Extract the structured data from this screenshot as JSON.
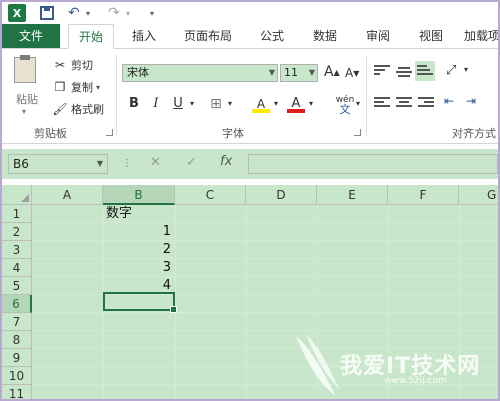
{
  "app_logo": "X",
  "tabs": [
    "文件",
    "开始",
    "插入",
    "页面布局",
    "公式",
    "数据",
    "审阅",
    "视图",
    "加载项"
  ],
  "active_tab": "开始",
  "ribbon": {
    "clipboard": {
      "paste": "粘贴",
      "cut": "剪切",
      "copy": "复制",
      "format_painter": "格式刷",
      "label": "剪贴板"
    },
    "font": {
      "name": "宋体",
      "size": "11",
      "grow": "A",
      "shrink": "A",
      "bold": "B",
      "italic": "I",
      "underline": "U",
      "phonetic": "wén",
      "phonetic_char": "文",
      "fill_char": "A",
      "font_color_char": "A",
      "label": "字体"
    },
    "alignment": {
      "label": "对齐方式"
    }
  },
  "formula_bar": {
    "name_box": "B6",
    "fx": "fx",
    "formula": ""
  },
  "grid": {
    "columns": [
      "A",
      "B",
      "C",
      "D",
      "E",
      "F",
      "G"
    ],
    "rows": [
      "1",
      "2",
      "3",
      "4",
      "5",
      "6",
      "7",
      "8",
      "9",
      "10",
      "11"
    ],
    "selected_column": "B",
    "selected_row": "6",
    "cells": {
      "B1": "数字",
      "B2": "1",
      "B3": "2",
      "B4": "3",
      "B5": "4"
    }
  },
  "watermark": {
    "text": "我爱IT技术网",
    "url": "www.52ij.com"
  },
  "colors": {
    "accent": "#217346",
    "sheet_bg": "#c8e6c9"
  }
}
